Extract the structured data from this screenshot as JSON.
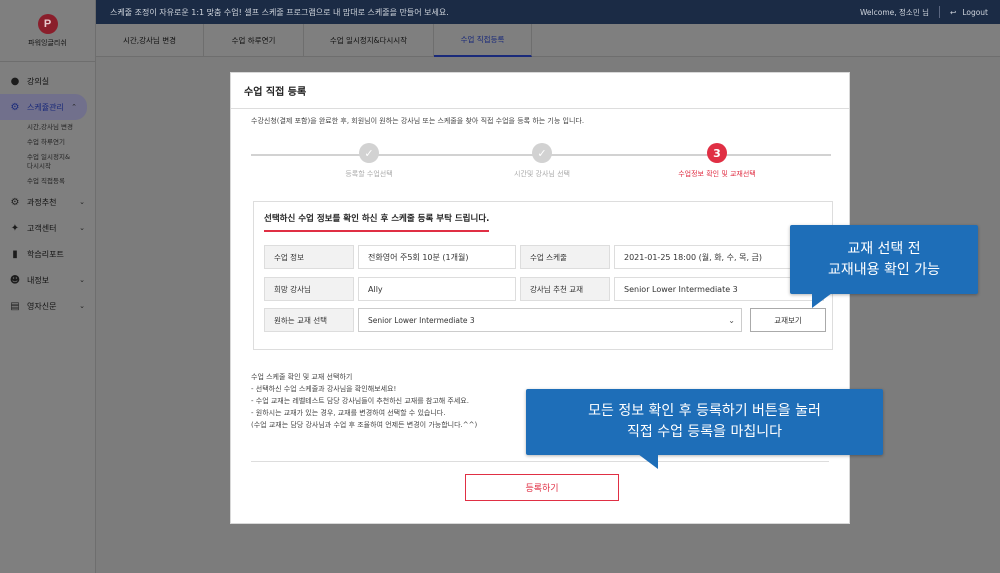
{
  "brand": {
    "logo_letter": "P",
    "name": "파워잉글리쉬"
  },
  "topbar": {
    "notice": "스케줄 조정이 자유로운 1:1 맞춤 수업! 셀프 스케줄 프로그램으로 내 맘대로 스케줄을 만들어 보세요.",
    "welcome": "Welcome, 정소민 님",
    "logout": "Logout"
  },
  "sidebar": {
    "items": [
      {
        "label": "강의실",
        "icon": "users-icon"
      },
      {
        "label": "스케쥴관리",
        "icon": "gear-icon"
      },
      {
        "label": "과정추천",
        "icon": "gear-icon"
      },
      {
        "label": "고객센터",
        "icon": "puzzle-icon"
      },
      {
        "label": "학습리포트",
        "icon": "chart-icon"
      },
      {
        "label": "내정보",
        "icon": "person-icon"
      },
      {
        "label": "영자신문",
        "icon": "newspaper-icon"
      }
    ],
    "sub_items": [
      "시간,강사님 변경",
      "수업 하루연기",
      "수업 일시정지&다시시작",
      "수업 직접등록"
    ]
  },
  "tabs": [
    "시간,강사님 변경",
    "수업 하루연기",
    "수업 일시정지&다시시작",
    "수업 직접등록"
  ],
  "modal": {
    "title": "수업 직접 등록",
    "description": "수강신청(결제 포함)을 완료한 후, 회원님이 원하는 강사님 또는 스케줄을 찾아 직접 수업을 등록 하는 기능 입니다.",
    "steps": [
      {
        "label": "등록할 수업선택",
        "mark": "✓"
      },
      {
        "label": "시간및 강사님 선택",
        "mark": "✓"
      },
      {
        "label": "수업정보 확인 및 교재선택",
        "mark": "3"
      }
    ],
    "card": {
      "heading": "선택하신 수업 정보를 확인 하신 후 스케줄 등록 부탁 드립니다.",
      "class_info_label": "수업 정보",
      "class_info_value": "전화영어 주5회 10분 (1개월)",
      "schedule_label": "수업 스케줄",
      "schedule_value": "2021-01-25 18:00 (월, 화, 수, 목, 금)",
      "teacher_label": "희망 강사님",
      "teacher_value": "Ally",
      "recommended_label": "강사님 추천 교재",
      "recommended_value": "Senior Lower Intermediate 3",
      "book_select_label": "원하는 교재 선택",
      "book_select_value": "Senior Lower Intermediate 3",
      "view_book_button": "교재보기"
    },
    "notes": [
      "수업 스케줄 확인 및 교재 선택하기",
      "- 선택하신 수업 스케줄과 강사님을 확인해보세요!",
      "- 수업 교재는 레벨테스트 담당 강사님들이 추천하신 교재를 참고해 주세요.",
      "- 원하시는 교재가 있는 경우, 교재를 변경하여 선택할 수 있습니다.",
      "(수업 교재는 담당 강사님과 수업 후 조율하여 언제든 변경이 가능합니다.^^)"
    ],
    "submit_button": "등록하기"
  },
  "callouts": {
    "book": [
      "교재 선택 전",
      "교재내용 확인 가능"
    ],
    "submit": [
      "모든 정보 확인 후 등록하기 버튼을 눌러",
      "직접 수업 등록을 마칩니다"
    ]
  }
}
